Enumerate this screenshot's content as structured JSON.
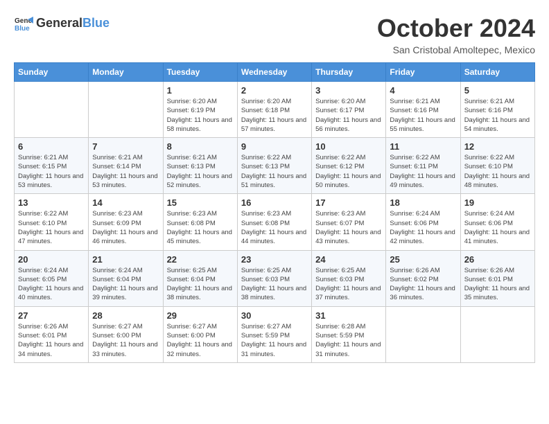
{
  "header": {
    "logo_line1": "General",
    "logo_line2": "Blue",
    "month": "October 2024",
    "location": "San Cristobal Amoltepec, Mexico"
  },
  "days_of_week": [
    "Sunday",
    "Monday",
    "Tuesday",
    "Wednesday",
    "Thursday",
    "Friday",
    "Saturday"
  ],
  "weeks": [
    [
      {
        "day": "",
        "info": ""
      },
      {
        "day": "",
        "info": ""
      },
      {
        "day": "1",
        "info": "Sunrise: 6:20 AM\nSunset: 6:19 PM\nDaylight: 11 hours and 58 minutes."
      },
      {
        "day": "2",
        "info": "Sunrise: 6:20 AM\nSunset: 6:18 PM\nDaylight: 11 hours and 57 minutes."
      },
      {
        "day": "3",
        "info": "Sunrise: 6:20 AM\nSunset: 6:17 PM\nDaylight: 11 hours and 56 minutes."
      },
      {
        "day": "4",
        "info": "Sunrise: 6:21 AM\nSunset: 6:16 PM\nDaylight: 11 hours and 55 minutes."
      },
      {
        "day": "5",
        "info": "Sunrise: 6:21 AM\nSunset: 6:16 PM\nDaylight: 11 hours and 54 minutes."
      }
    ],
    [
      {
        "day": "6",
        "info": "Sunrise: 6:21 AM\nSunset: 6:15 PM\nDaylight: 11 hours and 53 minutes."
      },
      {
        "day": "7",
        "info": "Sunrise: 6:21 AM\nSunset: 6:14 PM\nDaylight: 11 hours and 53 minutes."
      },
      {
        "day": "8",
        "info": "Sunrise: 6:21 AM\nSunset: 6:13 PM\nDaylight: 11 hours and 52 minutes."
      },
      {
        "day": "9",
        "info": "Sunrise: 6:22 AM\nSunset: 6:13 PM\nDaylight: 11 hours and 51 minutes."
      },
      {
        "day": "10",
        "info": "Sunrise: 6:22 AM\nSunset: 6:12 PM\nDaylight: 11 hours and 50 minutes."
      },
      {
        "day": "11",
        "info": "Sunrise: 6:22 AM\nSunset: 6:11 PM\nDaylight: 11 hours and 49 minutes."
      },
      {
        "day": "12",
        "info": "Sunrise: 6:22 AM\nSunset: 6:10 PM\nDaylight: 11 hours and 48 minutes."
      }
    ],
    [
      {
        "day": "13",
        "info": "Sunrise: 6:22 AM\nSunset: 6:10 PM\nDaylight: 11 hours and 47 minutes."
      },
      {
        "day": "14",
        "info": "Sunrise: 6:23 AM\nSunset: 6:09 PM\nDaylight: 11 hours and 46 minutes."
      },
      {
        "day": "15",
        "info": "Sunrise: 6:23 AM\nSunset: 6:08 PM\nDaylight: 11 hours and 45 minutes."
      },
      {
        "day": "16",
        "info": "Sunrise: 6:23 AM\nSunset: 6:08 PM\nDaylight: 11 hours and 44 minutes."
      },
      {
        "day": "17",
        "info": "Sunrise: 6:23 AM\nSunset: 6:07 PM\nDaylight: 11 hours and 43 minutes."
      },
      {
        "day": "18",
        "info": "Sunrise: 6:24 AM\nSunset: 6:06 PM\nDaylight: 11 hours and 42 minutes."
      },
      {
        "day": "19",
        "info": "Sunrise: 6:24 AM\nSunset: 6:06 PM\nDaylight: 11 hours and 41 minutes."
      }
    ],
    [
      {
        "day": "20",
        "info": "Sunrise: 6:24 AM\nSunset: 6:05 PM\nDaylight: 11 hours and 40 minutes."
      },
      {
        "day": "21",
        "info": "Sunrise: 6:24 AM\nSunset: 6:04 PM\nDaylight: 11 hours and 39 minutes."
      },
      {
        "day": "22",
        "info": "Sunrise: 6:25 AM\nSunset: 6:04 PM\nDaylight: 11 hours and 38 minutes."
      },
      {
        "day": "23",
        "info": "Sunrise: 6:25 AM\nSunset: 6:03 PM\nDaylight: 11 hours and 38 minutes."
      },
      {
        "day": "24",
        "info": "Sunrise: 6:25 AM\nSunset: 6:03 PM\nDaylight: 11 hours and 37 minutes."
      },
      {
        "day": "25",
        "info": "Sunrise: 6:26 AM\nSunset: 6:02 PM\nDaylight: 11 hours and 36 minutes."
      },
      {
        "day": "26",
        "info": "Sunrise: 6:26 AM\nSunset: 6:01 PM\nDaylight: 11 hours and 35 minutes."
      }
    ],
    [
      {
        "day": "27",
        "info": "Sunrise: 6:26 AM\nSunset: 6:01 PM\nDaylight: 11 hours and 34 minutes."
      },
      {
        "day": "28",
        "info": "Sunrise: 6:27 AM\nSunset: 6:00 PM\nDaylight: 11 hours and 33 minutes."
      },
      {
        "day": "29",
        "info": "Sunrise: 6:27 AM\nSunset: 6:00 PM\nDaylight: 11 hours and 32 minutes."
      },
      {
        "day": "30",
        "info": "Sunrise: 6:27 AM\nSunset: 5:59 PM\nDaylight: 11 hours and 31 minutes."
      },
      {
        "day": "31",
        "info": "Sunrise: 6:28 AM\nSunset: 5:59 PM\nDaylight: 11 hours and 31 minutes."
      },
      {
        "day": "",
        "info": ""
      },
      {
        "day": "",
        "info": ""
      }
    ]
  ]
}
